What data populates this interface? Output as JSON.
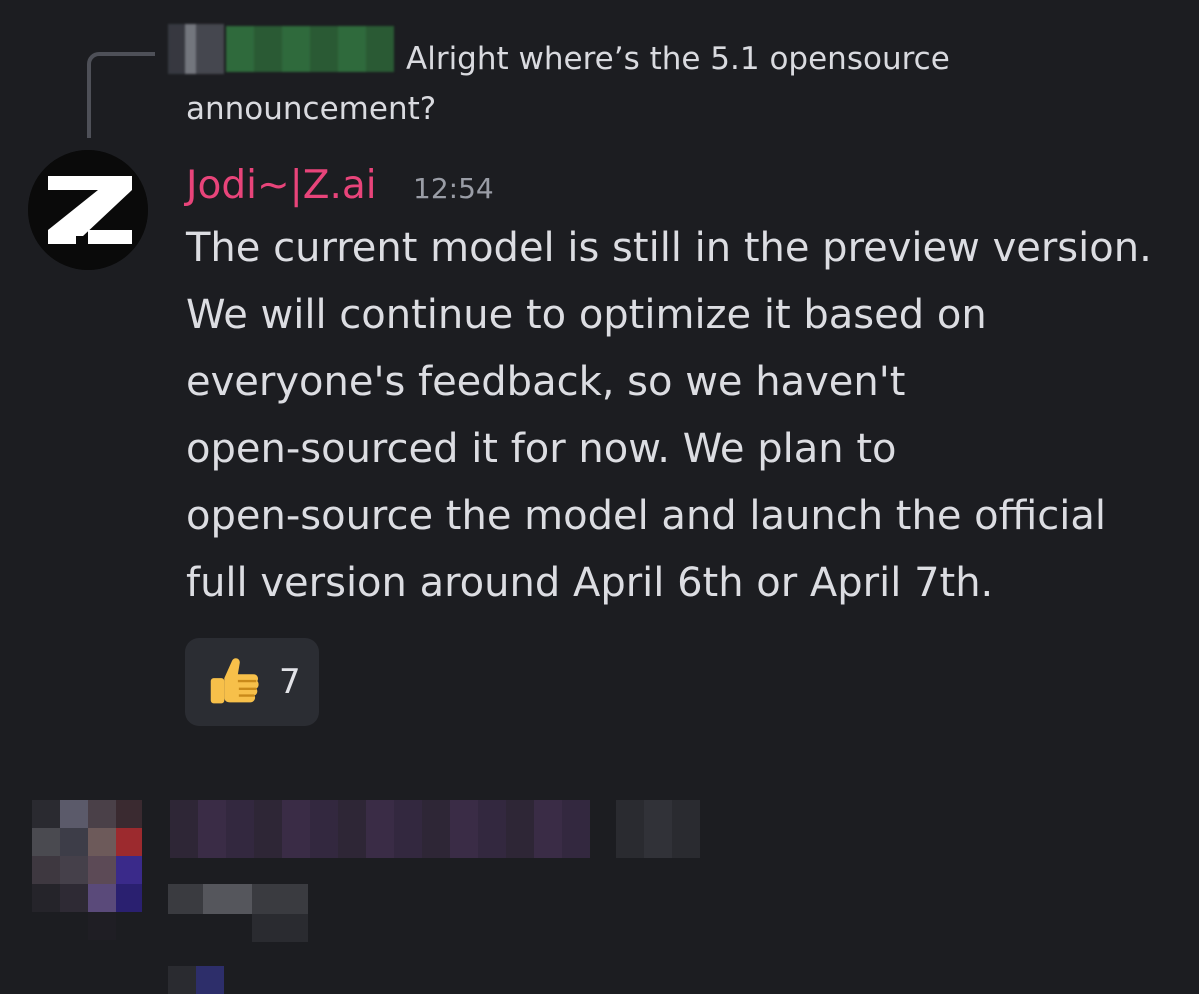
{
  "reply": {
    "text": "Alright where’s the 5.1 opensource announcement?"
  },
  "message": {
    "author": "Jodi~|Z.ai",
    "time": "12:54",
    "avatar_icon": "z-logo-icon",
    "lines": [
      "The current model is still in the preview version.",
      "We will continue to optimize it based on",
      "everyone's feedback, so we haven't",
      "open-sourced it for now. We plan to",
      "open-source the model and launch the official",
      "full version around April 6th or April 7th."
    ],
    "reaction": {
      "icon": "thumbs-up-icon",
      "count": "7"
    }
  },
  "colors": {
    "background": "#1c1d21",
    "username": "#e8447a",
    "reaction_bg": "#2b2d33"
  }
}
